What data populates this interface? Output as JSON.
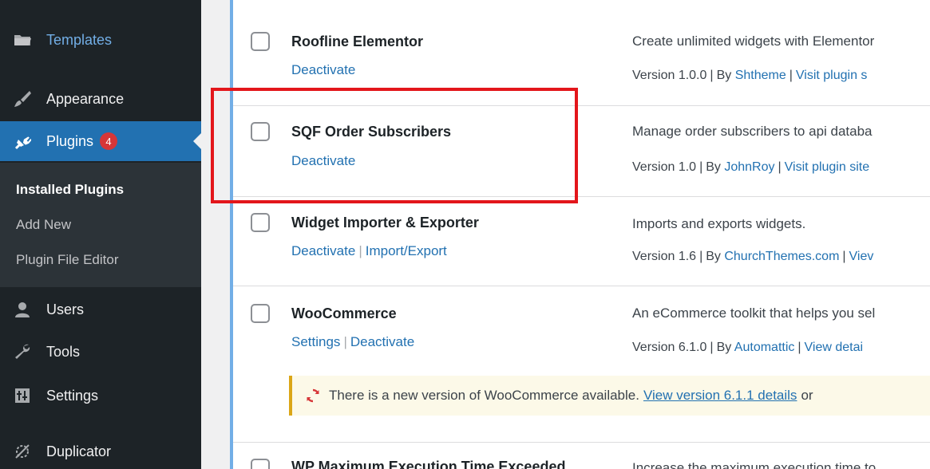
{
  "sidebar": {
    "items": [
      {
        "label": "Templates",
        "icon": "folder-icon"
      },
      {
        "label": "Appearance",
        "icon": "paintbrush-icon"
      },
      {
        "label": "Plugins",
        "icon": "plug-icon",
        "badge": "4"
      },
      {
        "label": "Users",
        "icon": "user-icon"
      },
      {
        "label": "Tools",
        "icon": "wrench-icon"
      },
      {
        "label": "Settings",
        "icon": "settings-icon"
      },
      {
        "label": "Duplicator",
        "icon": "duplicator-icon"
      }
    ],
    "submenu": [
      "Installed Plugins",
      "Add New",
      "Plugin File Editor"
    ]
  },
  "plugins": [
    {
      "name": "Roofline Elementor",
      "actions": [
        "Deactivate"
      ],
      "description": "Create unlimited widgets with Elementor",
      "version": "Version 1.0.0",
      "by_label": "By",
      "author": "Shtheme",
      "extra_link": "Visit plugin s"
    },
    {
      "name": "SQF Order Subscribers",
      "actions": [
        "Deactivate"
      ],
      "description": "Manage order subscribers to api databa",
      "version": "Version 1.0",
      "by_label": "By",
      "author": "JohnRoy",
      "extra_link": "Visit plugin site"
    },
    {
      "name": "Widget Importer & Exporter",
      "actions": [
        "Deactivate",
        "Import/Export"
      ],
      "description": "Imports and exports widgets.",
      "version": "Version 1.6",
      "by_label": "By",
      "author": "ChurchThemes.com",
      "extra_link": "Viev"
    },
    {
      "name": "WooCommerce",
      "actions": [
        "Settings",
        "Deactivate"
      ],
      "description": "An eCommerce toolkit that helps you sel",
      "version": "Version 6.1.0",
      "by_label": "By",
      "author": "Automattic",
      "extra_link": "View detai"
    },
    {
      "name": "WP Maximum Execution Time Exceeded",
      "actions": [],
      "description": "Increase the maximum execution time to",
      "version": "",
      "by_label": "",
      "author": "",
      "extra_link": ""
    }
  ],
  "update_notice": {
    "text": "There is a new version of WooCommerce available.",
    "link": "View version 6.1.1 details",
    "tail": "or"
  },
  "colors": {
    "sidebar_bg": "#1d2327",
    "active": "#2271b1",
    "badge": "#d63638",
    "link": "#2271b1",
    "highlight_box": "#e3161b",
    "notice_border": "#dba617"
  }
}
